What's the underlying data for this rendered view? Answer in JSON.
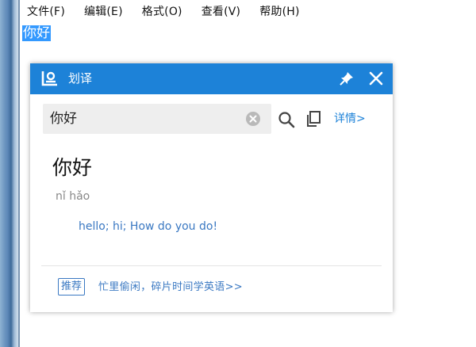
{
  "menubar": {
    "items": [
      "文件(F)",
      "编辑(E)",
      "格式(O)",
      "查看(V)",
      "帮助(H)"
    ]
  },
  "editor": {
    "selected_text": "你好"
  },
  "popup": {
    "title": "划译",
    "search": {
      "value": "你好"
    },
    "detail_link": "详情>",
    "entry": {
      "word": "你好",
      "pinyin": "nǐ hǎo",
      "meaning": "hello;  hi;  How do you do!"
    },
    "footer": {
      "badge": "推荐",
      "promo_text": "忙里偷闲，碎片时间学英语>>"
    },
    "icons": {
      "logo": "dictionary-logo-icon",
      "pin": "pin-icon",
      "close": "close-icon",
      "clear": "clear-icon",
      "search": "search-icon",
      "copy": "copy-icon"
    },
    "colors": {
      "header": "#1d82d8",
      "link": "#3a78c2",
      "selection": "#3399ff"
    }
  }
}
